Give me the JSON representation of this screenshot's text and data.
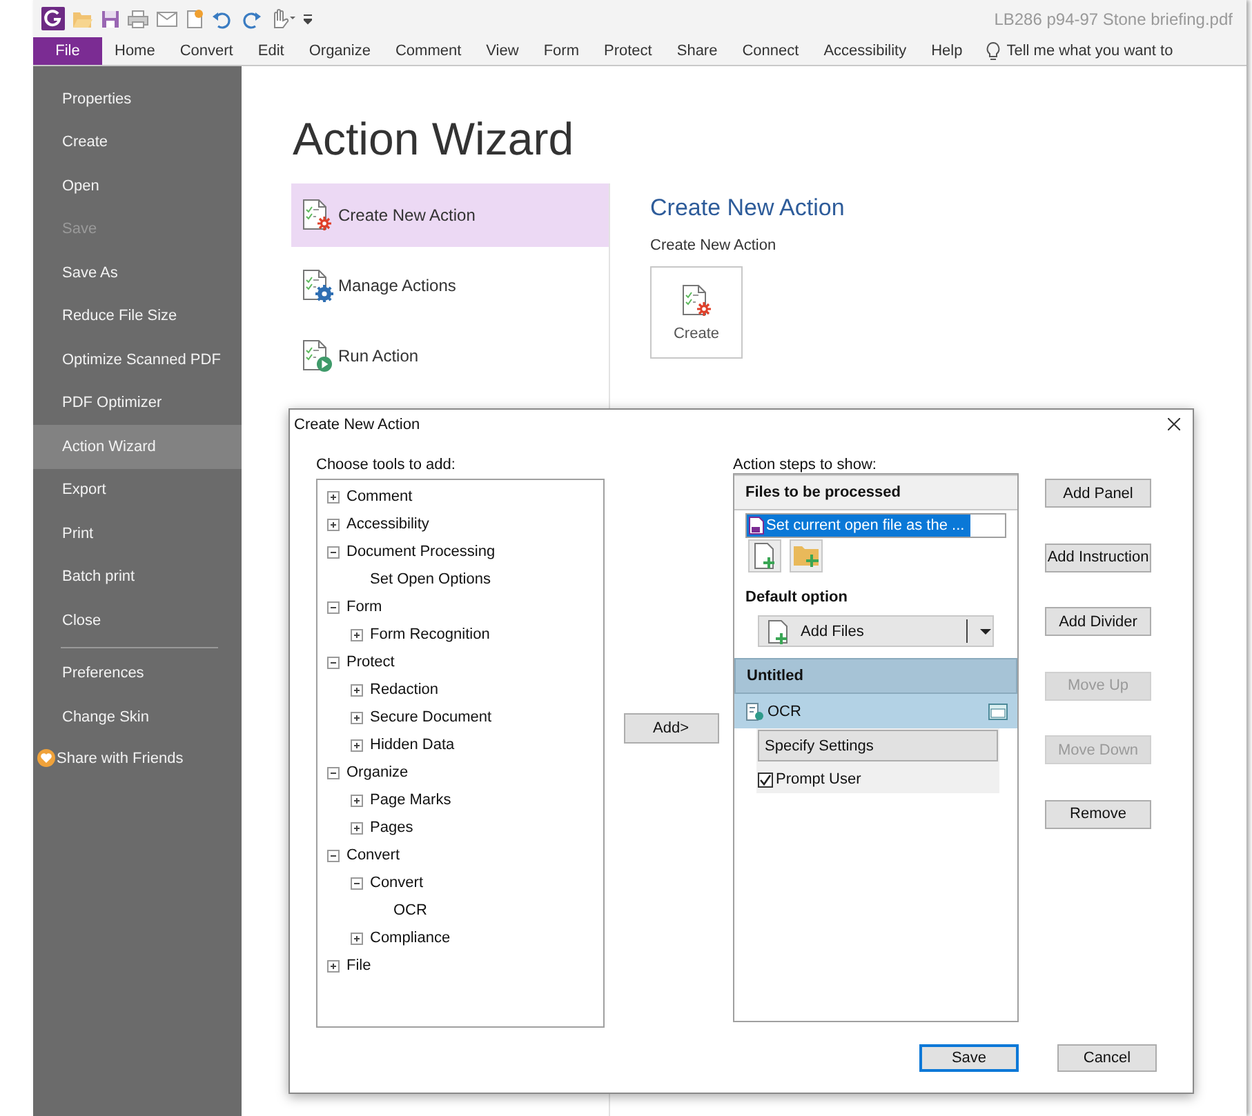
{
  "title_bar": {
    "document_title": "LB286 p94-97 Stone briefing.pdf"
  },
  "menu_bar": {
    "tabs": [
      {
        "label": "File",
        "selected": true
      },
      {
        "label": "Home",
        "selected": false
      },
      {
        "label": "Convert",
        "selected": false
      },
      {
        "label": "Edit",
        "selected": false
      },
      {
        "label": "Organize",
        "selected": false
      },
      {
        "label": "Comment",
        "selected": false
      },
      {
        "label": "View",
        "selected": false
      },
      {
        "label": "Form",
        "selected": false
      },
      {
        "label": "Protect",
        "selected": false
      },
      {
        "label": "Share",
        "selected": false
      },
      {
        "label": "Connect",
        "selected": false
      },
      {
        "label": "Accessibility",
        "selected": false
      },
      {
        "label": "Help",
        "selected": false
      }
    ],
    "search": {
      "placeholder": "Tell me what you want to"
    }
  },
  "sidebar": {
    "sections": [
      {
        "items": [
          {
            "label": "Properties",
            "kind": "plain",
            "selected": false,
            "disabled": false
          },
          {
            "label": "Create",
            "kind": "plain",
            "selected": false,
            "disabled": false
          },
          {
            "label": "Open",
            "kind": "plain",
            "selected": false,
            "disabled": false
          },
          {
            "label": "Save",
            "kind": "plain",
            "selected": false,
            "disabled": true
          },
          {
            "label": "Save As",
            "kind": "plain",
            "selected": false,
            "disabled": false
          },
          {
            "label": "Reduce File Size",
            "kind": "plain",
            "selected": false,
            "disabled": false
          },
          {
            "label": "Optimize Scanned PDF",
            "kind": "plain",
            "selected": false,
            "disabled": false
          },
          {
            "label": "PDF Optimizer",
            "kind": "plain",
            "selected": false,
            "disabled": false
          },
          {
            "label": "Action Wizard",
            "kind": "plain",
            "selected": true,
            "disabled": false
          },
          {
            "label": "Export",
            "kind": "plain",
            "selected": false,
            "disabled": false
          },
          {
            "label": "Print",
            "kind": "plain",
            "selected": false,
            "disabled": false
          },
          {
            "label": "Batch print",
            "kind": "plain",
            "selected": false,
            "disabled": false
          },
          {
            "label": "Close",
            "kind": "plain",
            "selected": false,
            "disabled": false
          }
        ]
      },
      {
        "items": [
          {
            "label": "Preferences",
            "kind": "plain",
            "selected": false,
            "disabled": false
          },
          {
            "label": "Change Skin",
            "kind": "plain",
            "selected": false,
            "disabled": false
          },
          {
            "label": "Share with Friends",
            "kind": "share",
            "selected": false,
            "disabled": false
          }
        ]
      }
    ]
  },
  "page": {
    "title": "Action Wizard",
    "actions": [
      {
        "label": "Create New Action",
        "kind": "create",
        "selected": true
      },
      {
        "label": "Manage Actions",
        "kind": "manage",
        "selected": false
      },
      {
        "label": "Run Action",
        "kind": "run",
        "selected": false
      }
    ],
    "detail": {
      "heading": "Create New Action",
      "subheading": "Create New Action",
      "button": "Create"
    }
  },
  "dialog": {
    "title": "Create New Action",
    "tools_label": "Choose tools to add:",
    "tools": [
      {
        "label": "Comment",
        "expanded": false
      },
      {
        "label": "Accessibility",
        "expanded": false
      },
      {
        "label": "Document Processing",
        "expanded": true,
        "children": [
          {
            "label": "Set Open Options"
          }
        ]
      },
      {
        "label": "Form",
        "expanded": true,
        "children": [
          {
            "label": "Form Recognition",
            "expanded": false
          }
        ]
      },
      {
        "label": "Protect",
        "expanded": true,
        "children": [
          {
            "label": "Redaction",
            "expanded": false
          },
          {
            "label": "Secure Document",
            "expanded": false
          },
          {
            "label": "Hidden Data",
            "expanded": false
          }
        ]
      },
      {
        "label": "Organize",
        "expanded": true,
        "children": [
          {
            "label": "Page Marks",
            "expanded": false
          },
          {
            "label": "Pages",
            "expanded": false
          }
        ]
      },
      {
        "label": "Convert",
        "expanded": true,
        "children": [
          {
            "label": "Convert",
            "expanded": true,
            "children": [
              {
                "label": "OCR"
              }
            ]
          },
          {
            "label": "Compliance",
            "expanded": false
          }
        ]
      },
      {
        "label": "File",
        "expanded": false
      }
    ],
    "add_button": "Add>",
    "steps_label": "Action steps to show:",
    "panels": [
      {
        "title": "Files to be processed",
        "kind": "files",
        "selected": false,
        "file": "Set current open file as the ...",
        "default_label": "Default option",
        "default_value": "Add Files"
      },
      {
        "title": "Untitled",
        "kind": "steps",
        "selected": true,
        "steps": [
          {
            "label": "OCR",
            "selected": true,
            "settings_button": "Specify Settings",
            "prompt_label": "Prompt User",
            "prompt_checked": true
          }
        ]
      }
    ],
    "side_buttons": [
      {
        "label": "Add Panel",
        "disabled": false
      },
      {
        "label": "Add Instruction",
        "disabled": false
      },
      {
        "label": "Add Divider",
        "disabled": false
      },
      {
        "label": "Move Up",
        "disabled": true
      },
      {
        "label": "Move Down",
        "disabled": true
      },
      {
        "label": "Remove",
        "disabled": false
      }
    ],
    "footer_buttons": [
      {
        "label": "Save",
        "default": true
      },
      {
        "label": "Cancel",
        "default": false
      }
    ]
  }
}
